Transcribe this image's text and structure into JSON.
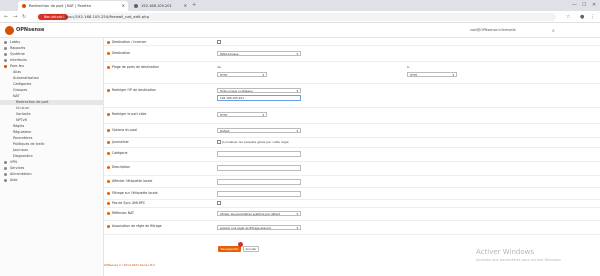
{
  "browser": {
    "tabs": [
      {
        "label": "Redirection de port | NAT | Parefeu"
      },
      {
        "label": "192.168.105.201"
      }
    ],
    "not_secure": "Non sécurisé",
    "url": "https://192.168.105.254/firewall_nat_edit.php"
  },
  "app": {
    "logo": "OPNsense",
    "user": "root@OPNsense.informatik",
    "footer": "OPNsense (c) 2014-2022 Deciso B.V."
  },
  "sidebar": {
    "items": [
      {
        "label": "Lobby",
        "icon": "home-icon"
      },
      {
        "label": "Rapports",
        "icon": "chart-icon"
      },
      {
        "label": "Système",
        "icon": "gear-icon"
      },
      {
        "label": "Interfaces",
        "icon": "network-icon"
      },
      {
        "label": "Pare-feu",
        "icon": "fire-icon"
      },
      {
        "label": "Alias"
      },
      {
        "label": "Automatisation"
      },
      {
        "label": "Catégories"
      },
      {
        "label": "Groupes"
      },
      {
        "label": "NAT"
      },
      {
        "label": "Redirection de port"
      },
      {
        "label": "Un-à-un"
      },
      {
        "label": "Sortante"
      },
      {
        "label": "NPTv6"
      },
      {
        "label": "Règles"
      },
      {
        "label": "Régulateur"
      },
      {
        "label": "Paramètres"
      },
      {
        "label": "Politiques de trafic"
      },
      {
        "label": "Journaux"
      },
      {
        "label": "Diagnostics"
      },
      {
        "label": "VPN",
        "icon": "lock-icon"
      },
      {
        "label": "Services",
        "icon": "cog-icon"
      },
      {
        "label": "Alimentation",
        "icon": "power-icon"
      },
      {
        "label": "Aide",
        "icon": "help-icon"
      }
    ]
  },
  "form": {
    "destination_inverse": "Destination / inverser",
    "destination": "Destination",
    "destination_value": "WAN adresse",
    "dest_port_range": "Plage de ports de destination",
    "de": "de:",
    "a": "à:",
    "port_from": "HTTP",
    "port_to": "HTTP",
    "redirect_ip": "Rediriger l'IP de destination",
    "redirect_ip_select": "Hôte unique ou Réseau",
    "redirect_ip_value": "192.168.105.201",
    "redirect_port": "Rediriger le port cible",
    "redirect_port_value": "HTTP",
    "pool_options": "Options du pool",
    "pool_options_value": "Défaut",
    "log": "Journaliser",
    "log_text": "Journaliser les paquets gérés par cette règle",
    "category": "Catégorie",
    "description": "Description",
    "set_tag": "Affecter l'étiquette locale",
    "match_tag": "Filtrage sur l'étiquette locale",
    "no_xmlrpc": "Pas de Sync XMLRPC",
    "nat_reflection": "Réflexion NAT",
    "nat_reflection_value": "Utiliser les paramètres système par défaut",
    "filter_assoc": "Association de règle de filtrage",
    "filter_assoc_value": "Ajouter une règle de filtrage associé",
    "save": "Sauvegarder",
    "cancel": "Annuler"
  },
  "watermark": {
    "title": "Activer Windows",
    "subtitle": "Accédez aux paramètres pour activer Windows."
  }
}
